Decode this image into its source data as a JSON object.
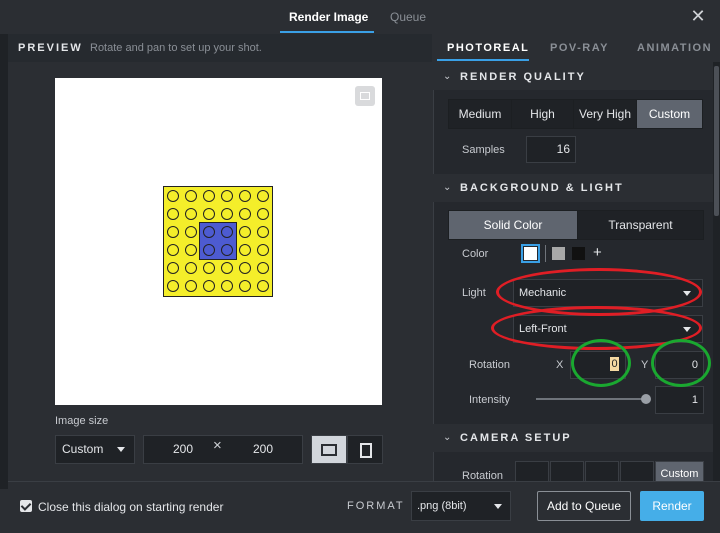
{
  "header": {
    "tabs": [
      {
        "label": "Render Image",
        "active": true
      },
      {
        "label": "Queue",
        "active": false
      }
    ],
    "close_icon": "close-icon"
  },
  "preview": {
    "title": "PREVIEW",
    "subtitle": "Rotate and pan to set up your shot.",
    "image_size_label": "Image size",
    "size_mode": "Custom",
    "width": "200",
    "height": "200",
    "times": "×"
  },
  "right": {
    "tabs": [
      "PHOTOREAL",
      "POV-RAY",
      "ANIMATION"
    ],
    "active_tab": "PHOTOREAL",
    "render_quality": {
      "title": "RENDER QUALITY",
      "options": [
        "Medium",
        "High",
        "Very High",
        "Custom"
      ],
      "selected": "Custom",
      "samples_label": "Samples",
      "samples_value": "16"
    },
    "background_light": {
      "title": "BACKGROUND & LIGHT",
      "modes": [
        "Solid Color",
        "Transparent"
      ],
      "selected_mode": "Solid Color",
      "color_label": "Color",
      "swatches": [
        "#ffffff",
        "#a8a8a8",
        "#111111"
      ],
      "add_symbol": "+",
      "light_label": "Light",
      "light_value": "Mechanic",
      "direction_value": "Left-Front",
      "rotation_label": "Rotation",
      "x_label": "X",
      "x_value": "0",
      "y_label": "Y",
      "y_value": "0",
      "intensity_label": "Intensity",
      "intensity_value": "1"
    },
    "camera_setup": {
      "title": "CAMERA SETUP",
      "rotation_label": "Rotation",
      "custom_label": "Custom"
    }
  },
  "footer": {
    "close_dialog_label": "Close this dialog on starting render",
    "close_dialog_checked": true,
    "format_label": "FORMAT",
    "format_value": ".png (8bit)",
    "add_to_queue": "Add to Queue",
    "render": "Render"
  },
  "colors": {
    "accent": "#45aee8",
    "brick_yellow": "#f4ee2a",
    "brick_blue": "#4d5bd1",
    "annotation_red": "#e01e25",
    "annotation_green": "#1aa830"
  }
}
